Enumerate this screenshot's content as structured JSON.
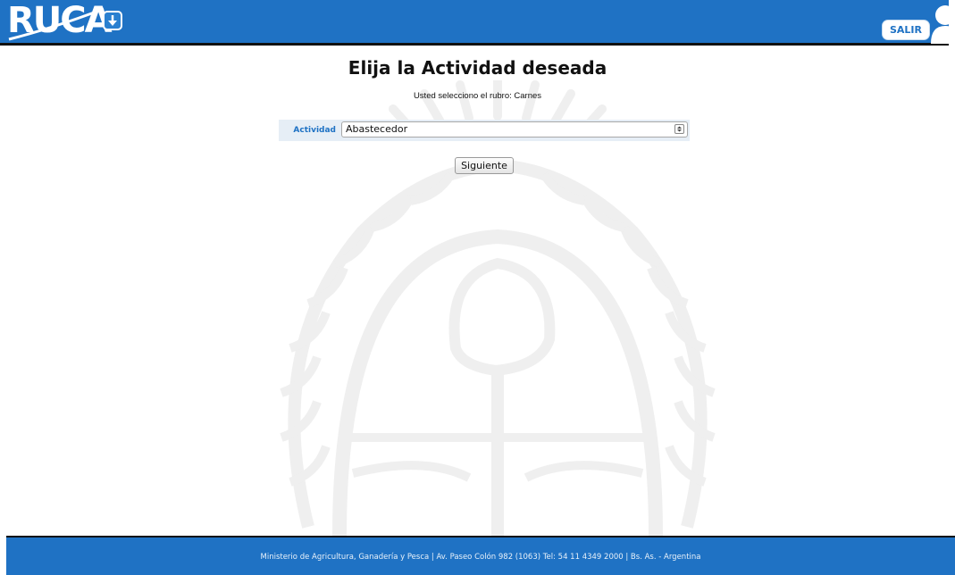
{
  "header": {
    "logo_text": "RUCA",
    "logout_label": "SALIR"
  },
  "main": {
    "title": "Elija la Actividad deseada",
    "subtitle": "Usted selecciono el rubro: Carnes",
    "activity_label": "Actividad",
    "activity_selected": "Abastecedor",
    "next_label": "Siguiente"
  },
  "footer": {
    "text": "Ministerio de Agricultura, Ganadería y Pesca | Av. Paseo Colón 982 (1063) Tel: 54 11 4349 2000 | Bs. As. - Argentina"
  },
  "colors": {
    "brand_blue": "#1f72c4",
    "header_border": "#111111"
  }
}
